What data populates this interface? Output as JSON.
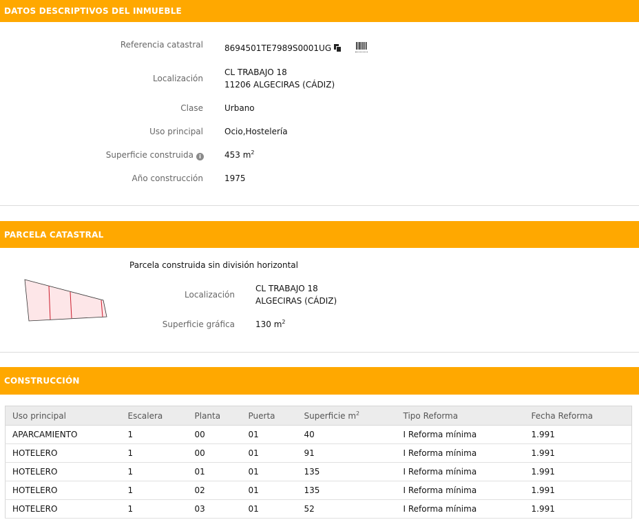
{
  "descriptivos": {
    "header": "DATOS DESCRIPTIVOS DEL INMUEBLE",
    "referencia_label": "Referencia catastral",
    "referencia_value": "8694501TE7989S0001UG",
    "localizacion_label": "Localización",
    "localizacion_line1": "CL TRABAJO 18",
    "localizacion_line2": "11206 ALGECIRAS (CÁDIZ)",
    "clase_label": "Clase",
    "clase_value": "Urbano",
    "uso_label": "Uso principal",
    "uso_value": "Ocio,Hostelería",
    "superficie_label": "Superficie construida",
    "superficie_value": "453 m",
    "superficie_unit_exp": "2",
    "info_icon_glyph": "i",
    "anio_label": "Año construcción",
    "anio_value": "1975"
  },
  "parcela": {
    "header": "PARCELA CATASTRAL",
    "subtitle": "Parcela construida sin división horizontal",
    "localizacion_label": "Localización",
    "localizacion_line1": "CL TRABAJO 18",
    "localizacion_line2": "ALGECIRAS (CÁDIZ)",
    "superficie_label": "Superficie gráfica",
    "superficie_value": "130 m",
    "superficie_unit_exp": "2"
  },
  "construccion": {
    "header": "CONSTRUCCIÓN",
    "columns": [
      "Uso principal",
      "Escalera",
      "Planta",
      "Puerta",
      "Superficie m",
      "Tipo Reforma",
      "Fecha Reforma"
    ],
    "superficie_exp": "2",
    "rows": [
      [
        "APARCAMIENTO",
        "1",
        "00",
        "01",
        "40",
        "I Reforma mínima",
        "1.991"
      ],
      [
        "HOTELERO",
        "1",
        "00",
        "01",
        "91",
        "I Reforma mínima",
        "1.991"
      ],
      [
        "HOTELERO",
        "1",
        "01",
        "01",
        "135",
        "I Reforma mínima",
        "1.991"
      ],
      [
        "HOTELERO",
        "1",
        "02",
        "01",
        "135",
        "I Reforma mínima",
        "1.991"
      ],
      [
        "HOTELERO",
        "1",
        "03",
        "01",
        "52",
        "I Reforma mínima",
        "1.991"
      ]
    ]
  },
  "colors": {
    "accent": "#ffa800",
    "parcel_fill": "#fde6e8",
    "parcel_line": "#cc1b2b"
  },
  "icons": {
    "copy": "copy-icon",
    "barcode": "barcode-icon",
    "info": "info-icon"
  }
}
